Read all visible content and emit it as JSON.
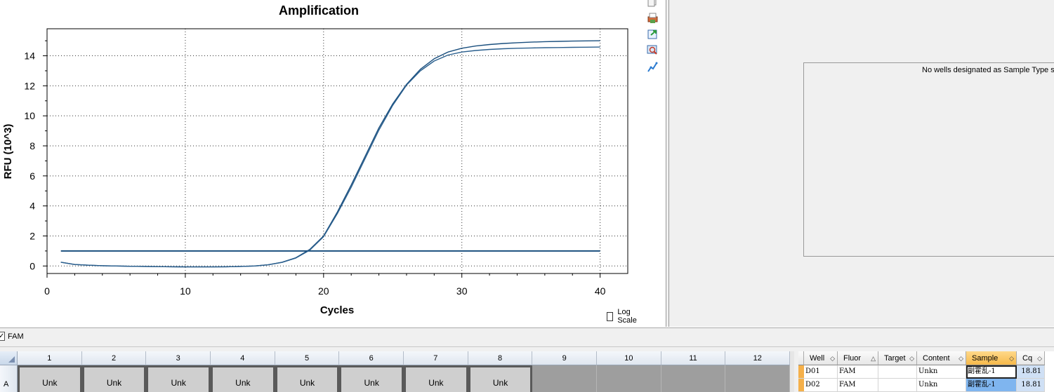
{
  "chart_data": {
    "type": "line",
    "title": "Amplification",
    "xlabel": "Cycles",
    "ylabel": "RFU (10^3)",
    "xlim": [
      0,
      42
    ],
    "ylim": [
      -0.5,
      15.8
    ],
    "xticks": [
      0,
      10,
      20,
      30,
      40
    ],
    "yticks": [
      0,
      2,
      4,
      6,
      8,
      10,
      12,
      14
    ],
    "grid": true,
    "series": [
      {
        "x": [
          1,
          2,
          3,
          4,
          5,
          6,
          7,
          8,
          9,
          10,
          11,
          12,
          13,
          14,
          15,
          16,
          17,
          18,
          19,
          20,
          21,
          22,
          23,
          24,
          25,
          26,
          27,
          28,
          29,
          30,
          31,
          32,
          33,
          34,
          35,
          36,
          37,
          38,
          39,
          40
        ],
        "values": [
          0.25,
          0.1,
          0.05,
          0.02,
          0.0,
          -0.02,
          -0.03,
          -0.04,
          -0.05,
          -0.06,
          -0.06,
          -0.06,
          -0.05,
          -0.03,
          0.0,
          0.08,
          0.25,
          0.55,
          1.1,
          2.0,
          3.6,
          5.4,
          7.3,
          9.2,
          10.8,
          12.1,
          13.1,
          13.8,
          14.25,
          14.5,
          14.65,
          14.75,
          14.82,
          14.87,
          14.91,
          14.94,
          14.96,
          14.98,
          14.99,
          15.0
        ],
        "color": "#1a4f7e"
      },
      {
        "x": [
          1,
          2,
          3,
          4,
          5,
          6,
          7,
          8,
          9,
          10,
          11,
          12,
          13,
          14,
          15,
          16,
          17,
          18,
          19,
          20,
          21,
          22,
          23,
          24,
          25,
          26,
          27,
          28,
          29,
          30,
          31,
          32,
          33,
          34,
          35,
          36,
          37,
          38,
          39,
          40
        ],
        "values": [
          0.25,
          0.1,
          0.05,
          0.02,
          0.0,
          -0.02,
          -0.03,
          -0.04,
          -0.05,
          -0.06,
          -0.06,
          -0.06,
          -0.05,
          -0.03,
          0.0,
          0.08,
          0.24,
          0.53,
          1.05,
          1.95,
          3.5,
          5.25,
          7.15,
          9.05,
          10.7,
          12.05,
          13.0,
          13.65,
          14.05,
          14.25,
          14.35,
          14.42,
          14.47,
          14.5,
          14.52,
          14.54,
          14.55,
          14.56,
          14.57,
          14.58
        ],
        "color": "#2a5f8e"
      }
    ],
    "threshold": {
      "value": 1.0,
      "x_range": [
        1,
        40
      ],
      "color": "#1a4f7e"
    }
  },
  "log_scale_label": "Log Scale",
  "toolstrip": {
    "icons": [
      "copy-icon",
      "print-icon",
      "export-icon",
      "magnify-icon",
      "curve-icon"
    ]
  },
  "standard_curve": {
    "message": "No wells designated as Sample Type sta"
  },
  "fluor_filter": {
    "label": "FAM",
    "checked": true
  },
  "plate": {
    "row_label": "A",
    "columns": [
      "1",
      "2",
      "3",
      "4",
      "5",
      "6",
      "7",
      "8",
      "9",
      "10",
      "11",
      "12"
    ],
    "wells": [
      "Unk",
      "Unk",
      "Unk",
      "Unk",
      "Unk",
      "Unk",
      "Unk",
      "Unk",
      "",
      "",
      "",
      ""
    ]
  },
  "results_table": {
    "headers": [
      "Well",
      "Fluor",
      "Target",
      "Content",
      "Sample",
      "Cq"
    ],
    "rows": [
      [
        "D01",
        "FAM",
        "",
        "Unkn",
        "副霍乱-1",
        "18.81"
      ],
      [
        "D02",
        "FAM",
        "",
        "Unkn",
        "副霍乱-1",
        "18.81"
      ]
    ]
  },
  "colors": {
    "curve": "#1a4f7e",
    "selected_header": "#f6b94a",
    "selection_blue": "#7fb5ef"
  }
}
